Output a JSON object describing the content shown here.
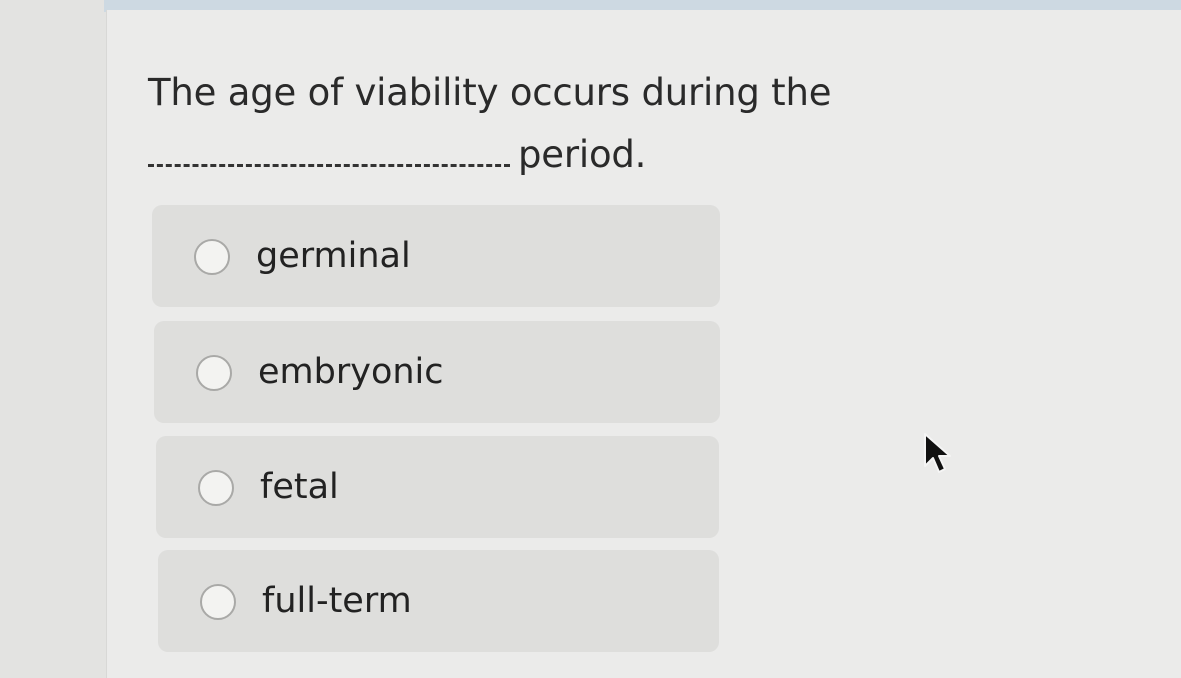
{
  "question": {
    "line1": "The age of viability occurs during the",
    "line2_suffix": "period."
  },
  "options": [
    {
      "label": "germinal",
      "selected": false
    },
    {
      "label": "embryonic",
      "selected": false
    },
    {
      "label": "fetal",
      "selected": false
    },
    {
      "label": "full-term",
      "selected": false
    }
  ],
  "colors": {
    "page_bg": "#ebebea",
    "option_bg": "#dededc",
    "text": "#222222",
    "top_strip": "#cdd9e2"
  },
  "icons": {
    "radio": "radio-circle-icon",
    "cursor": "mouse-pointer-icon"
  }
}
